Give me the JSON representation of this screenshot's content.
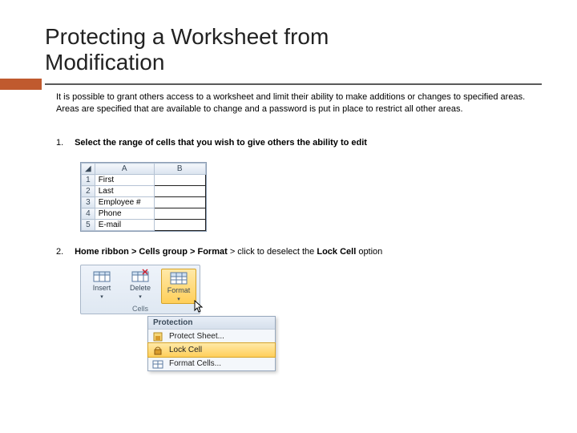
{
  "title_line1": "Protecting a Worksheet from",
  "title_line2": "Modification",
  "intro": "It is possible to grant others access to a worksheet and limit their ability to make additions or changes to specified areas. Areas are specified that are available to change and a password is put in place to restrict all other areas.",
  "steps": {
    "s1": {
      "num": "1.",
      "text": "Select the range of cells that you wish to give others the ability to edit"
    },
    "s2": {
      "num": "2.",
      "pre": "Home ribbon > Cells group > Format",
      "mid": " > click to deselect the ",
      "post": "Lock Cell",
      "tail": " option"
    }
  },
  "sheet": {
    "colA": "A",
    "colB": "B",
    "rows": [
      {
        "n": "1",
        "a": "First"
      },
      {
        "n": "2",
        "a": "Last"
      },
      {
        "n": "3",
        "a": "Employee #"
      },
      {
        "n": "4",
        "a": "Phone"
      },
      {
        "n": "5",
        "a": "E-mail"
      }
    ]
  },
  "cells_group": {
    "insert": "Insert",
    "delete": "Delete",
    "format": "Format",
    "label": "Cells"
  },
  "menu": {
    "header": "Protection",
    "protect": "Protect Sheet...",
    "lock": "Lock Cell",
    "formatcells": "Format Cells..."
  }
}
